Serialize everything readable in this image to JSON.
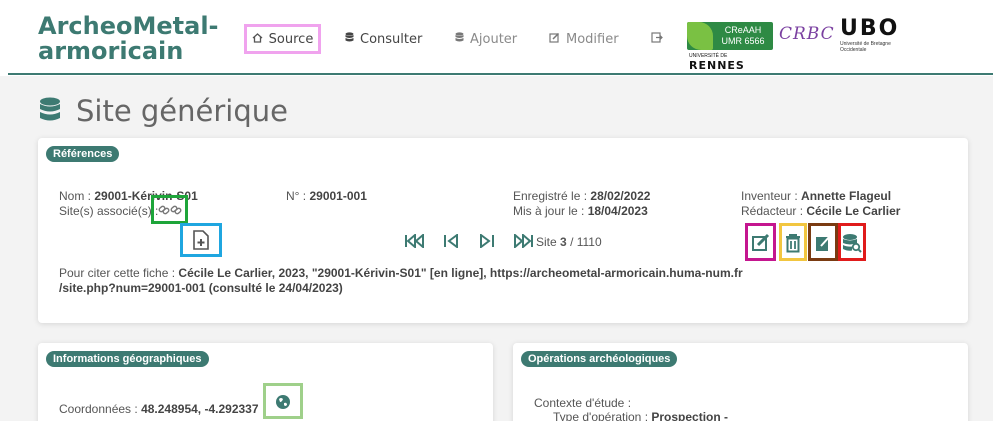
{
  "brand": {
    "line1": "ArcheoMetal-",
    "line2": "armoricain"
  },
  "nav": {
    "source": "Source",
    "consulter": "Consulter",
    "ajouter": "Ajouter",
    "modifier": "Modifier"
  },
  "logos": {
    "creaah_line1": "CReAAH",
    "creaah_line2": "UMR 6566",
    "crbc": "CRBC",
    "ubo": "UBO",
    "ubo_sub": "Université de Bretagne Occidentale",
    "rennes_sub": "UNIVERSITÉ DE",
    "rennes": "RENNES"
  },
  "page": {
    "title": "Site générique"
  },
  "references": {
    "badge": "Références",
    "nom_label": "Nom :",
    "nom_value": "29001-Kérivin-S01",
    "sites_associes_label": "Site(s) associé(s) :",
    "numero_label": "N° :",
    "numero_value": "29001-001",
    "enregistre_label": "Enregistré le :",
    "enregistre_value": "28/02/2022",
    "maj_label": "Mis à jour le :",
    "maj_value": "18/04/2023",
    "inventeur_label": "Inventeur :",
    "inventeur_value": "Annette Flageul",
    "redacteur_label": "Rédacteur :",
    "redacteur_value": "Cécile Le Carlier",
    "pager_label": "Site",
    "pager_current": "3",
    "pager_total": "/ 1110",
    "cite_label": "Pour citer cette fiche :",
    "cite_line1": "Cécile Le Carlier, 2023, \"29001-Kérivin-S01\" [en ligne], https://archeometal-armoricain.huma-num.fr",
    "cite_line2": "/site.php?num=29001-001 (consulté le 24/04/2023)"
  },
  "geo": {
    "badge": "Informations géographiques",
    "coords_label": "Coordonnées :",
    "coords_value": "48.248954, -4.292337"
  },
  "ops": {
    "badge": "Opérations archéologiques",
    "contexte_label": "Contexte d'étude :",
    "type_label": "Type d'opération :",
    "type_value": "Prospection -"
  },
  "colors": {
    "accent": "#3d7a72",
    "highlight_source": "#f0a3ee",
    "highlight_link": "#1ea53a",
    "highlight_add": "#1fa6e0",
    "highlight_edit": "#c4168f",
    "highlight_delete": "#f2c640",
    "highlight_export": "#7a3b12",
    "highlight_search": "#e01b1b",
    "highlight_map": "#9fd08a"
  },
  "icons": [
    "home-icon",
    "database-icon",
    "pen-square-icon",
    "sign-out-icon",
    "link-icon",
    "file-plus-icon",
    "first-icon",
    "previous-icon",
    "next-icon",
    "last-icon",
    "edit-icon",
    "trash-icon",
    "export-icon",
    "database-search-icon",
    "globe-icon"
  ]
}
